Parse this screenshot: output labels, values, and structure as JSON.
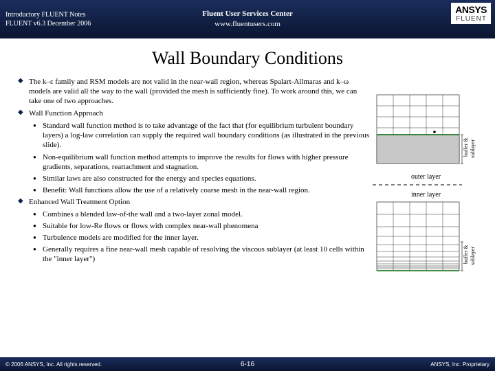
{
  "header": {
    "line1": "Introductory FLUENT Notes",
    "line2": "FLUENT v6.3 December 2006",
    "center1": "Fluent User Services Center",
    "center2": "www.fluentusers.com",
    "logo_brand": "ANSYS",
    "logo_product": "FLUENT"
  },
  "title": "Wall Boundary Conditions",
  "bullets": [
    {
      "level": 1,
      "text": "The k–ε family and RSM models are not valid in the near-wall region, whereas Spalart-Allmaras and k–ω models are valid all the way to the wall (provided the mesh is sufficiently fine). To work around this, we can take one of two approaches."
    },
    {
      "level": 1,
      "text": "Wall Function Approach"
    },
    {
      "level": 2,
      "text": "Standard wall function method is to take advantage of the fact that (for equilibrium turbulent boundary layers) a log-law correlation can supply the required wall boundary conditions (as illustrated in the previous slide)."
    },
    {
      "level": 2,
      "text": "Non-equilibrium wall function method attempts to improve the results for flows with higher pressure gradients, separations, reattachment and stagnation."
    },
    {
      "level": 2,
      "text": "Similar laws are also constructed for the energy and species equations."
    },
    {
      "level": 2,
      "text": "Benefit: Wall functions allow the use of a relatively coarse mesh in the near-wall region."
    },
    {
      "level": 1,
      "text": "Enhanced Wall Treatment Option"
    },
    {
      "level": 2,
      "text": "Combines a blended law-of-the wall and a two-layer zonal model."
    },
    {
      "level": 2,
      "text": "Suitable for low-Re flows or flows with complex near-wall phenomena"
    },
    {
      "level": 2,
      "text": "Turbulence models are modified for the inner layer."
    },
    {
      "level": 2,
      "text": "Generally requires a fine near-wall mesh capable of resolving the viscous sublayer (at least 10 cells within the \"inner layer\")"
    }
  ],
  "fig": {
    "label_outer": "outer layer",
    "label_inner": "inner layer",
    "side_buffer": "buffer &",
    "side_sublayer": "sublayer"
  },
  "footer": {
    "left": "© 2006 ANSYS, Inc. All rights reserved.",
    "page": "6-16",
    "right": "ANSYS, Inc. Proprietary"
  }
}
